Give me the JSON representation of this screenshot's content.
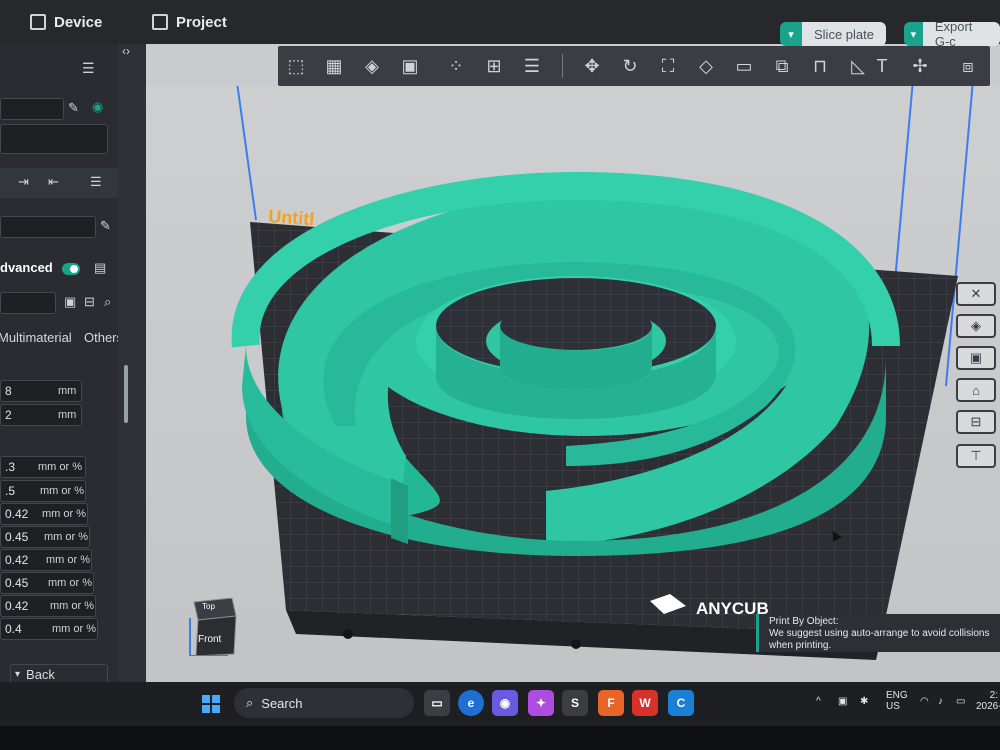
{
  "topbar": {
    "device_label": "Device",
    "project_label": "Project",
    "slice_label": "Slice plate",
    "export_label": "Export G-c"
  },
  "left_panel": {
    "advanced_label": "dvanced",
    "tab_multimaterial": "Multimaterial",
    "tab_others": "Others",
    "fields": [
      {
        "value": "8",
        "unit": "mm"
      },
      {
        "value": "2",
        "unit": "mm"
      },
      {
        "value": ".3",
        "unit": "mm or %"
      },
      {
        "value": ".5",
        "unit": "mm or %"
      },
      {
        "value": "0.42",
        "unit": "mm or %"
      },
      {
        "value": "0.45",
        "unit": "mm or %"
      },
      {
        "value": "0.42",
        "unit": "mm or %"
      },
      {
        "value": "0.45",
        "unit": "mm or %"
      },
      {
        "value": "0.42",
        "unit": "mm or %"
      },
      {
        "value": "0.4",
        "unit": "mm or %"
      }
    ],
    "back_label": "Back"
  },
  "viewport": {
    "plate_title": "Untitl",
    "brand_text": "ANYCUB",
    "cube_top": "Top",
    "cube_front": "Front",
    "model_color": "#2fc6a3",
    "plate_color": "#2c2e33"
  },
  "toast": {
    "title": "Print By Object:",
    "message": "We suggest using auto-arrange to avoid collisions when printing."
  },
  "taskbar": {
    "search_label": "Search",
    "lang_top": "ENG",
    "lang_bottom": "US",
    "time": "2:",
    "date": "2026-"
  },
  "colors": {
    "accent": "#1aa38c"
  }
}
